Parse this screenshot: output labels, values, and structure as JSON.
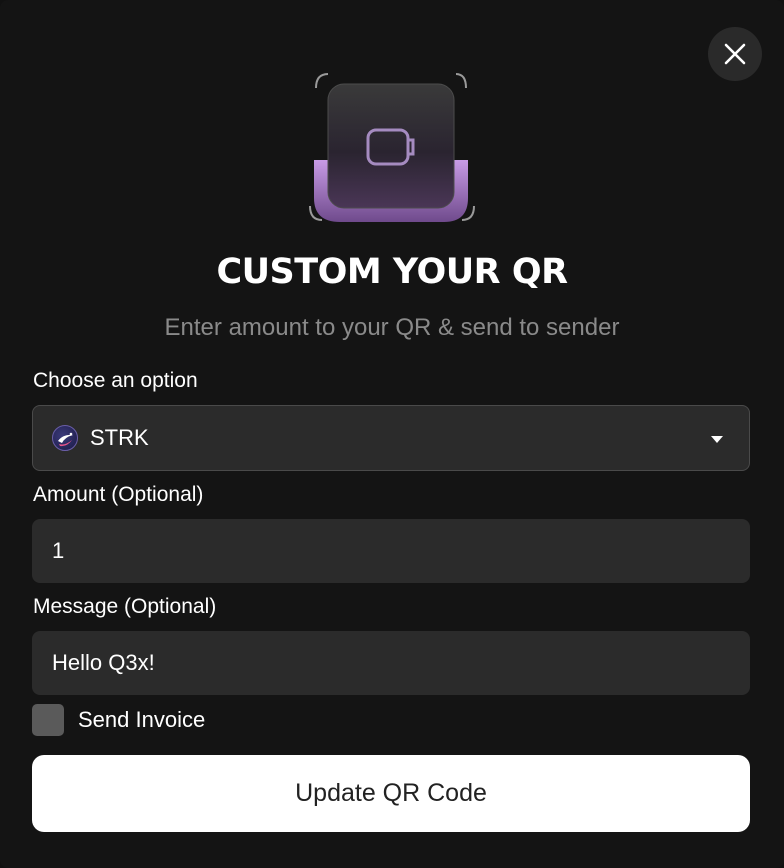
{
  "close": {
    "icon": "close-icon"
  },
  "hero": {
    "icon": "wallet-icon"
  },
  "title": "CUSTOM YOUR QR",
  "subtitle": "Enter amount to your QR & send to sender",
  "option": {
    "label": "Choose an option",
    "selected": "STRK",
    "token_icon": "starknet-token-icon"
  },
  "amount": {
    "label": "Amount (Optional)",
    "value": "1"
  },
  "message": {
    "label": "Message (Optional)",
    "value": "Hello Q3x!"
  },
  "invoice": {
    "label": "Send Invoice",
    "checked": false
  },
  "submit": {
    "label": "Update QR Code"
  },
  "colors": {
    "background": "#141414",
    "field": "#2b2b2b",
    "accent": "#b98ad6",
    "button": "#ffffff"
  }
}
